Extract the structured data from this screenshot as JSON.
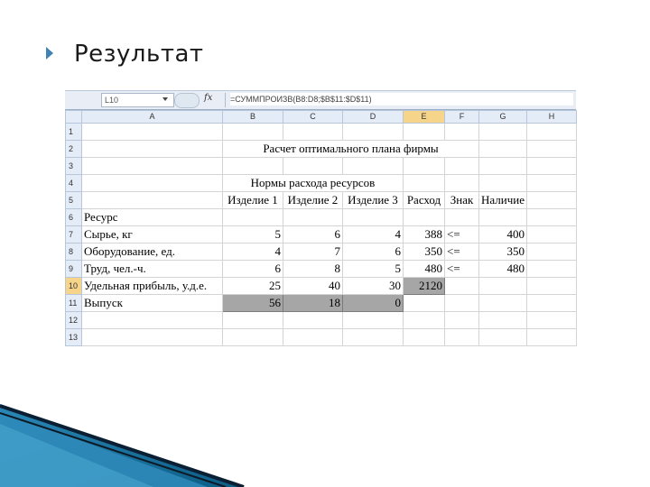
{
  "slide": {
    "title": "Результат"
  },
  "excel": {
    "name_box": "L10",
    "fx_label": "fx",
    "formula": "=СУММПРОИЗВ(B8:D8;$B$11:$D$11)",
    "columns": [
      "A",
      "B",
      "C",
      "D",
      "E",
      "F",
      "G",
      "H"
    ],
    "rows": [
      "1",
      "2",
      "3",
      "4",
      "5",
      "6",
      "7",
      "8",
      "9",
      "10",
      "11",
      "12",
      "13"
    ],
    "cells": {
      "title": "Расчет оптимального плана фирмы",
      "norms_header": "Нормы расхода ресурсов",
      "b5": "Изделие 1",
      "c5": "Изделие 2",
      "d5": "Изделие 3",
      "e5": "Расход",
      "f5": "Знак",
      "g5": "Наличие",
      "a6": "Ресурс",
      "a7": "Сырье, кг",
      "b7": "5",
      "c7": "6",
      "d7": "4",
      "e7": "388",
      "f7": "<=",
      "g7": "400",
      "a8": "Оборудование, ед.",
      "b8": "4",
      "c8": "7",
      "d8": "6",
      "e8": "350",
      "f8": "<=",
      "g8": "350",
      "a9": "Труд, чел.-ч.",
      "b9": "6",
      "c9": "8",
      "d9": "5",
      "e9": "480",
      "f9": "<=",
      "g9": "480",
      "a10": "Удельная прибыль, у.д.е.",
      "b10": "25",
      "c10": "40",
      "d10": "30",
      "e10": "2120",
      "a11": "Выпуск",
      "b11": "56",
      "c11": "18",
      "d11": "0"
    }
  }
}
